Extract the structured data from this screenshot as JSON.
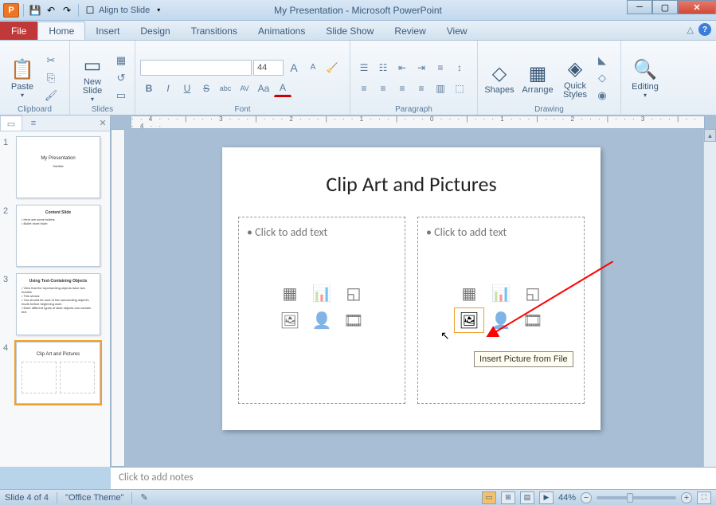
{
  "titlebar": {
    "app": "P",
    "save": "💾",
    "undo": "↶",
    "redo": "↷",
    "align_label": "Align to Slide",
    "title": "My Presentation - Microsoft PowerPoint"
  },
  "tabs": {
    "file": "File",
    "home": "Home",
    "insert": "Insert",
    "design": "Design",
    "transitions": "Transitions",
    "animations": "Animations",
    "slideshow": "Slide Show",
    "review": "Review",
    "view": "View"
  },
  "ribbon": {
    "clipboard": {
      "label": "Clipboard",
      "paste": "Paste",
      "cut": "✂",
      "copy": "⎘",
      "painter": "🖌"
    },
    "slides": {
      "label": "Slides",
      "new_slide": "New\nSlide",
      "layout": "▦",
      "reset": "↺",
      "section": "▭"
    },
    "font": {
      "label": "Font",
      "family": "",
      "size": "44",
      "grow": "A",
      "shrink": "A",
      "bold": "B",
      "italic": "I",
      "underline": "U",
      "strike": "S",
      "shadow": "abc",
      "spacing": "AV",
      "case": "Aa",
      "color": "A"
    },
    "paragraph": {
      "label": "Paragraph"
    },
    "drawing": {
      "label": "Drawing",
      "shapes": "Shapes",
      "arrange": "Arrange",
      "quick": "Quick\nStyles"
    },
    "editing": {
      "label": "Editing",
      "find": "Editing"
    }
  },
  "thumbs": [
    {
      "num": "1",
      "title": "My Presentation",
      "sub": "Subtitle"
    },
    {
      "num": "2",
      "title": "Content Slide",
      "lines": "• Here are some bullets\n• Bullet short blurb"
    },
    {
      "num": "3",
      "title": "Using Text-Containing Objects",
      "lines": "• View that the representing objects have two models\n• This shows\n• You should be sure of the surrounding object's mode before beginning work\n• More different types of slide objects can contain text"
    },
    {
      "num": "4",
      "title": "Clip Art and Pictures",
      "selected": true
    }
  ],
  "slide": {
    "title": "Clip Art and Pictures",
    "placeholder_text": "Click to add text",
    "tooltip": "Insert Picture from File"
  },
  "notes": {
    "placeholder": "Click to add notes"
  },
  "statusbar": {
    "slide": "Slide 4 of 4",
    "theme": "\"Office Theme\"",
    "zoom": "44%"
  }
}
